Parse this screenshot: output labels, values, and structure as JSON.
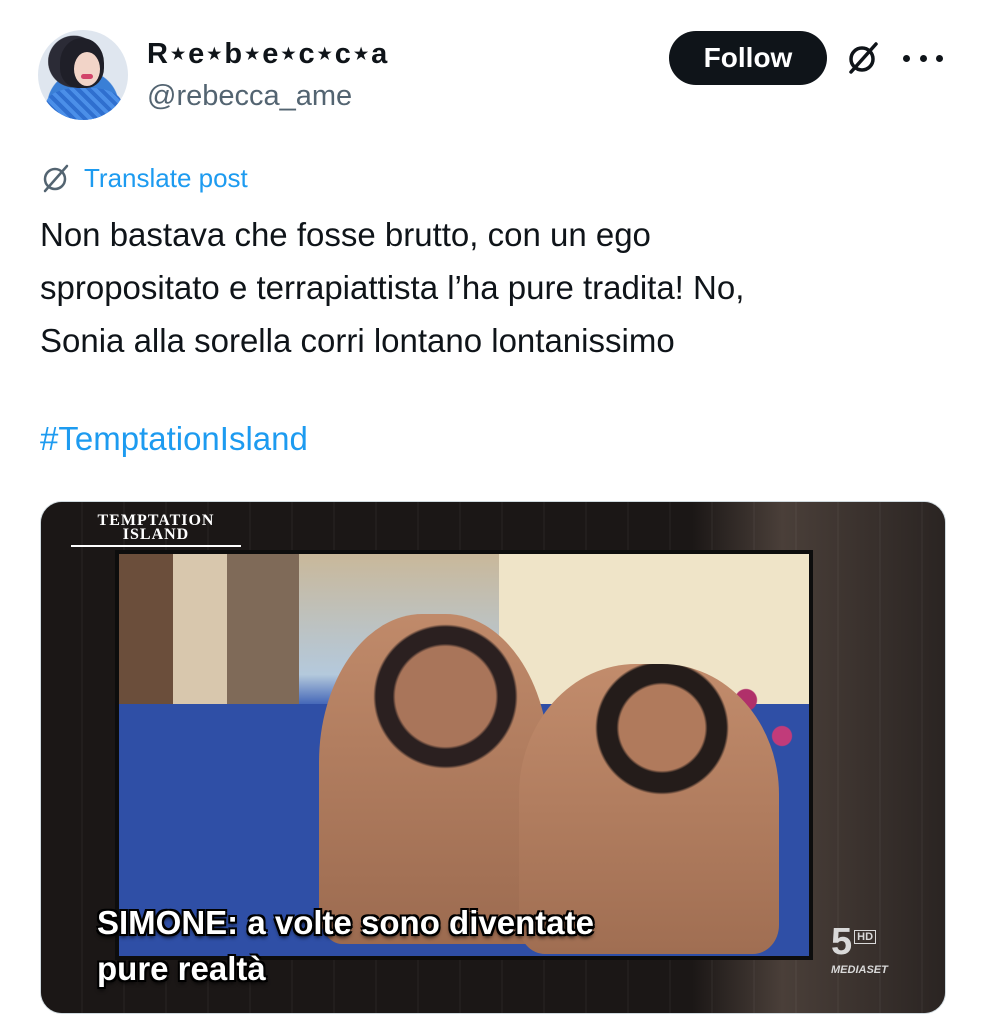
{
  "author": {
    "display_name": "R⋆e⋆b⋆e⋆c⋆c⋆a",
    "handle": "@rebecca_ame",
    "avatar_icon": "user-avatar"
  },
  "header": {
    "follow_label": "Follow",
    "grok_icon": "grok-icon",
    "more_icon": "more-options-icon"
  },
  "translate": {
    "label": "Translate post",
    "icon": "translate-icon"
  },
  "post": {
    "lines": [
      "Non bastava che fosse brutto, con un ego",
      "spropositato e terrapiattista l’ha pure tradita! No,",
      "Sonia alla sorella corri lontano lontanissimo"
    ],
    "hashtag": "#TemptationIsland"
  },
  "media": {
    "logo_line1": "TEMPTATION",
    "logo_line2": "ISLAND",
    "caption_line1": "SIMONE: a volte sono diventate",
    "caption_line2": "pure realtà",
    "channel_number": "5",
    "channel_hd": "HD",
    "channel_brand": "MEDIASET"
  },
  "colors": {
    "accent": "#1d9bf0",
    "text": "#0f1419",
    "secondary": "#536471",
    "button_bg": "#0f1419"
  }
}
